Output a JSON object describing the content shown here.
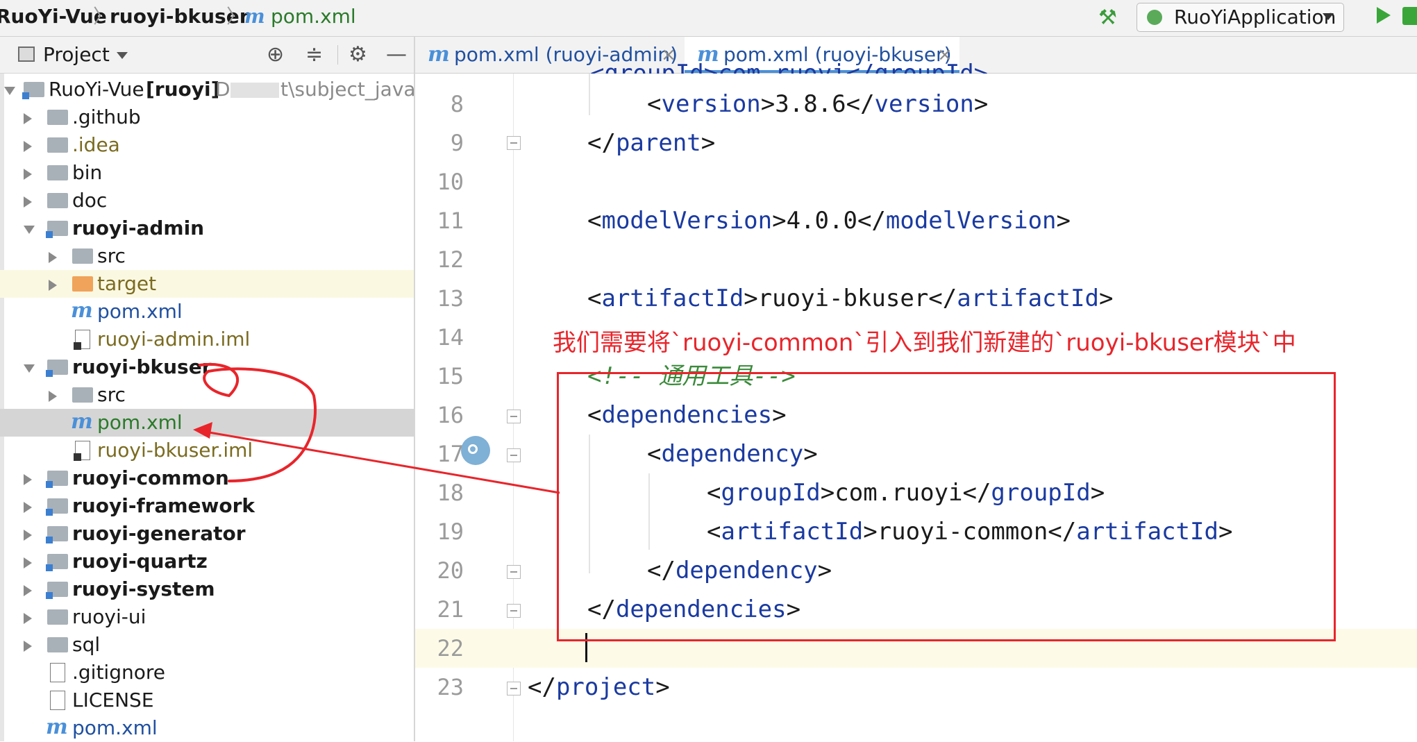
{
  "breadcrumb": {
    "project": "RuoYi-Vue",
    "module": "ruoyi-bkuser",
    "file_icon": "m",
    "file": "pom.xml"
  },
  "toolbar": {
    "build_icon": "hammer-icon",
    "run_config": "RuoYiApplication"
  },
  "project_panel": {
    "title": "Project",
    "tree": [
      {
        "label": "RuoYi-Vue",
        "suffix": "[ruoyi]",
        "path": "D",
        "path_tail": "t\\subject_java\\c"
      },
      {
        "label": ".github"
      },
      {
        "label": ".idea"
      },
      {
        "label": "bin"
      },
      {
        "label": "doc"
      },
      {
        "label": "ruoyi-admin"
      },
      {
        "label": "src"
      },
      {
        "label": "target"
      },
      {
        "label": "pom.xml"
      },
      {
        "label": "ruoyi-admin.iml"
      },
      {
        "label": "ruoyi-bkuser"
      },
      {
        "label": "src"
      },
      {
        "label": "pom.xml"
      },
      {
        "label": "ruoyi-bkuser.iml"
      },
      {
        "label": "ruoyi-common"
      },
      {
        "label": "ruoyi-framework"
      },
      {
        "label": "ruoyi-generator"
      },
      {
        "label": "ruoyi-quartz"
      },
      {
        "label": "ruoyi-system"
      },
      {
        "label": "ruoyi-ui"
      },
      {
        "label": "sql"
      },
      {
        "label": ".gitignore"
      },
      {
        "label": "LICENSE"
      },
      {
        "label": "pom.xml"
      }
    ]
  },
  "tabs": [
    {
      "icon": "m",
      "label": "pom.xml (ruoyi-admin)",
      "close": "×"
    },
    {
      "icon": "m",
      "label": "pom.xml (ruoyi-bkuser)",
      "close": "×"
    }
  ],
  "editor": {
    "lines": [
      {
        "num": "8",
        "tokens": [
          {
            "t": "<",
            "c": "bracket"
          },
          {
            "t": "version",
            "c": "tag"
          },
          {
            "t": ">3.8.6</",
            "c": "text"
          },
          {
            "t": "version",
            "c": "tag"
          },
          {
            "t": ">",
            "c": "bracket"
          }
        ]
      },
      {
        "num": "9",
        "tokens": [
          {
            "t": "</",
            "c": "bracket"
          },
          {
            "t": "parent",
            "c": "tag"
          },
          {
            "t": ">",
            "c": "bracket"
          }
        ]
      },
      {
        "num": "10",
        "tokens": []
      },
      {
        "num": "11",
        "tokens": [
          {
            "t": "<",
            "c": "bracket"
          },
          {
            "t": "modelVersion",
            "c": "tag"
          },
          {
            "t": ">4.0.0</",
            "c": "text"
          },
          {
            "t": "modelVersion",
            "c": "tag"
          },
          {
            "t": ">",
            "c": "bracket"
          }
        ]
      },
      {
        "num": "12",
        "tokens": []
      },
      {
        "num": "13",
        "tokens": [
          {
            "t": "<",
            "c": "bracket"
          },
          {
            "t": "artifactId",
            "c": "tag"
          },
          {
            "t": ">ruoyi-bkuser</",
            "c": "text"
          },
          {
            "t": "artifactId",
            "c": "tag"
          },
          {
            "t": ">",
            "c": "bracket"
          }
        ]
      },
      {
        "num": "14",
        "tokens": []
      },
      {
        "num": "15",
        "tokens": [
          {
            "t": "<!-- 通用工具-->",
            "c": "comment"
          }
        ]
      },
      {
        "num": "16",
        "tokens": [
          {
            "t": "<",
            "c": "bracket"
          },
          {
            "t": "dependencies",
            "c": "tag"
          },
          {
            "t": ">",
            "c": "bracket"
          }
        ]
      },
      {
        "num": "17",
        "tokens": [
          {
            "t": "<",
            "c": "bracket"
          },
          {
            "t": "dependency",
            "c": "tag"
          },
          {
            "t": ">",
            "c": "bracket"
          }
        ]
      },
      {
        "num": "18",
        "tokens": [
          {
            "t": "<",
            "c": "bracket"
          },
          {
            "t": "groupId",
            "c": "tag"
          },
          {
            "t": ">com.ruoyi</",
            "c": "text"
          },
          {
            "t": "groupId",
            "c": "tag"
          },
          {
            "t": ">",
            "c": "bracket"
          }
        ]
      },
      {
        "num": "19",
        "tokens": [
          {
            "t": "<",
            "c": "bracket"
          },
          {
            "t": "artifactId",
            "c": "tag"
          },
          {
            "t": ">ruoyi-common</",
            "c": "text"
          },
          {
            "t": "artifactId",
            "c": "tag"
          },
          {
            "t": ">",
            "c": "bracket"
          }
        ]
      },
      {
        "num": "20",
        "tokens": [
          {
            "t": "</",
            "c": "bracket"
          },
          {
            "t": "dependency",
            "c": "tag"
          },
          {
            "t": ">",
            "c": "bracket"
          }
        ]
      },
      {
        "num": "21",
        "tokens": [
          {
            "t": "</",
            "c": "bracket"
          },
          {
            "t": "dependencies",
            "c": "tag"
          },
          {
            "t": ">",
            "c": "bracket"
          }
        ]
      },
      {
        "num": "22",
        "tokens": []
      },
      {
        "num": "23",
        "tokens": [
          {
            "t": "</",
            "c": "bracket"
          },
          {
            "t": "project",
            "c": "tag"
          },
          {
            "t": ">",
            "c": "bracket"
          }
        ]
      }
    ]
  },
  "annotation": {
    "text": "我们需要将`ruoyi-common`引入到我们新建的`ruoyi-bkuser模块`中",
    "color": "#e8252b"
  },
  "colors": {
    "tag": "#1a3aa0",
    "comment": "#3a8a3a",
    "line_number": "#9b9b9b",
    "selected_row": "#d5d5d5",
    "excluded_row": "#fbf8e2"
  }
}
